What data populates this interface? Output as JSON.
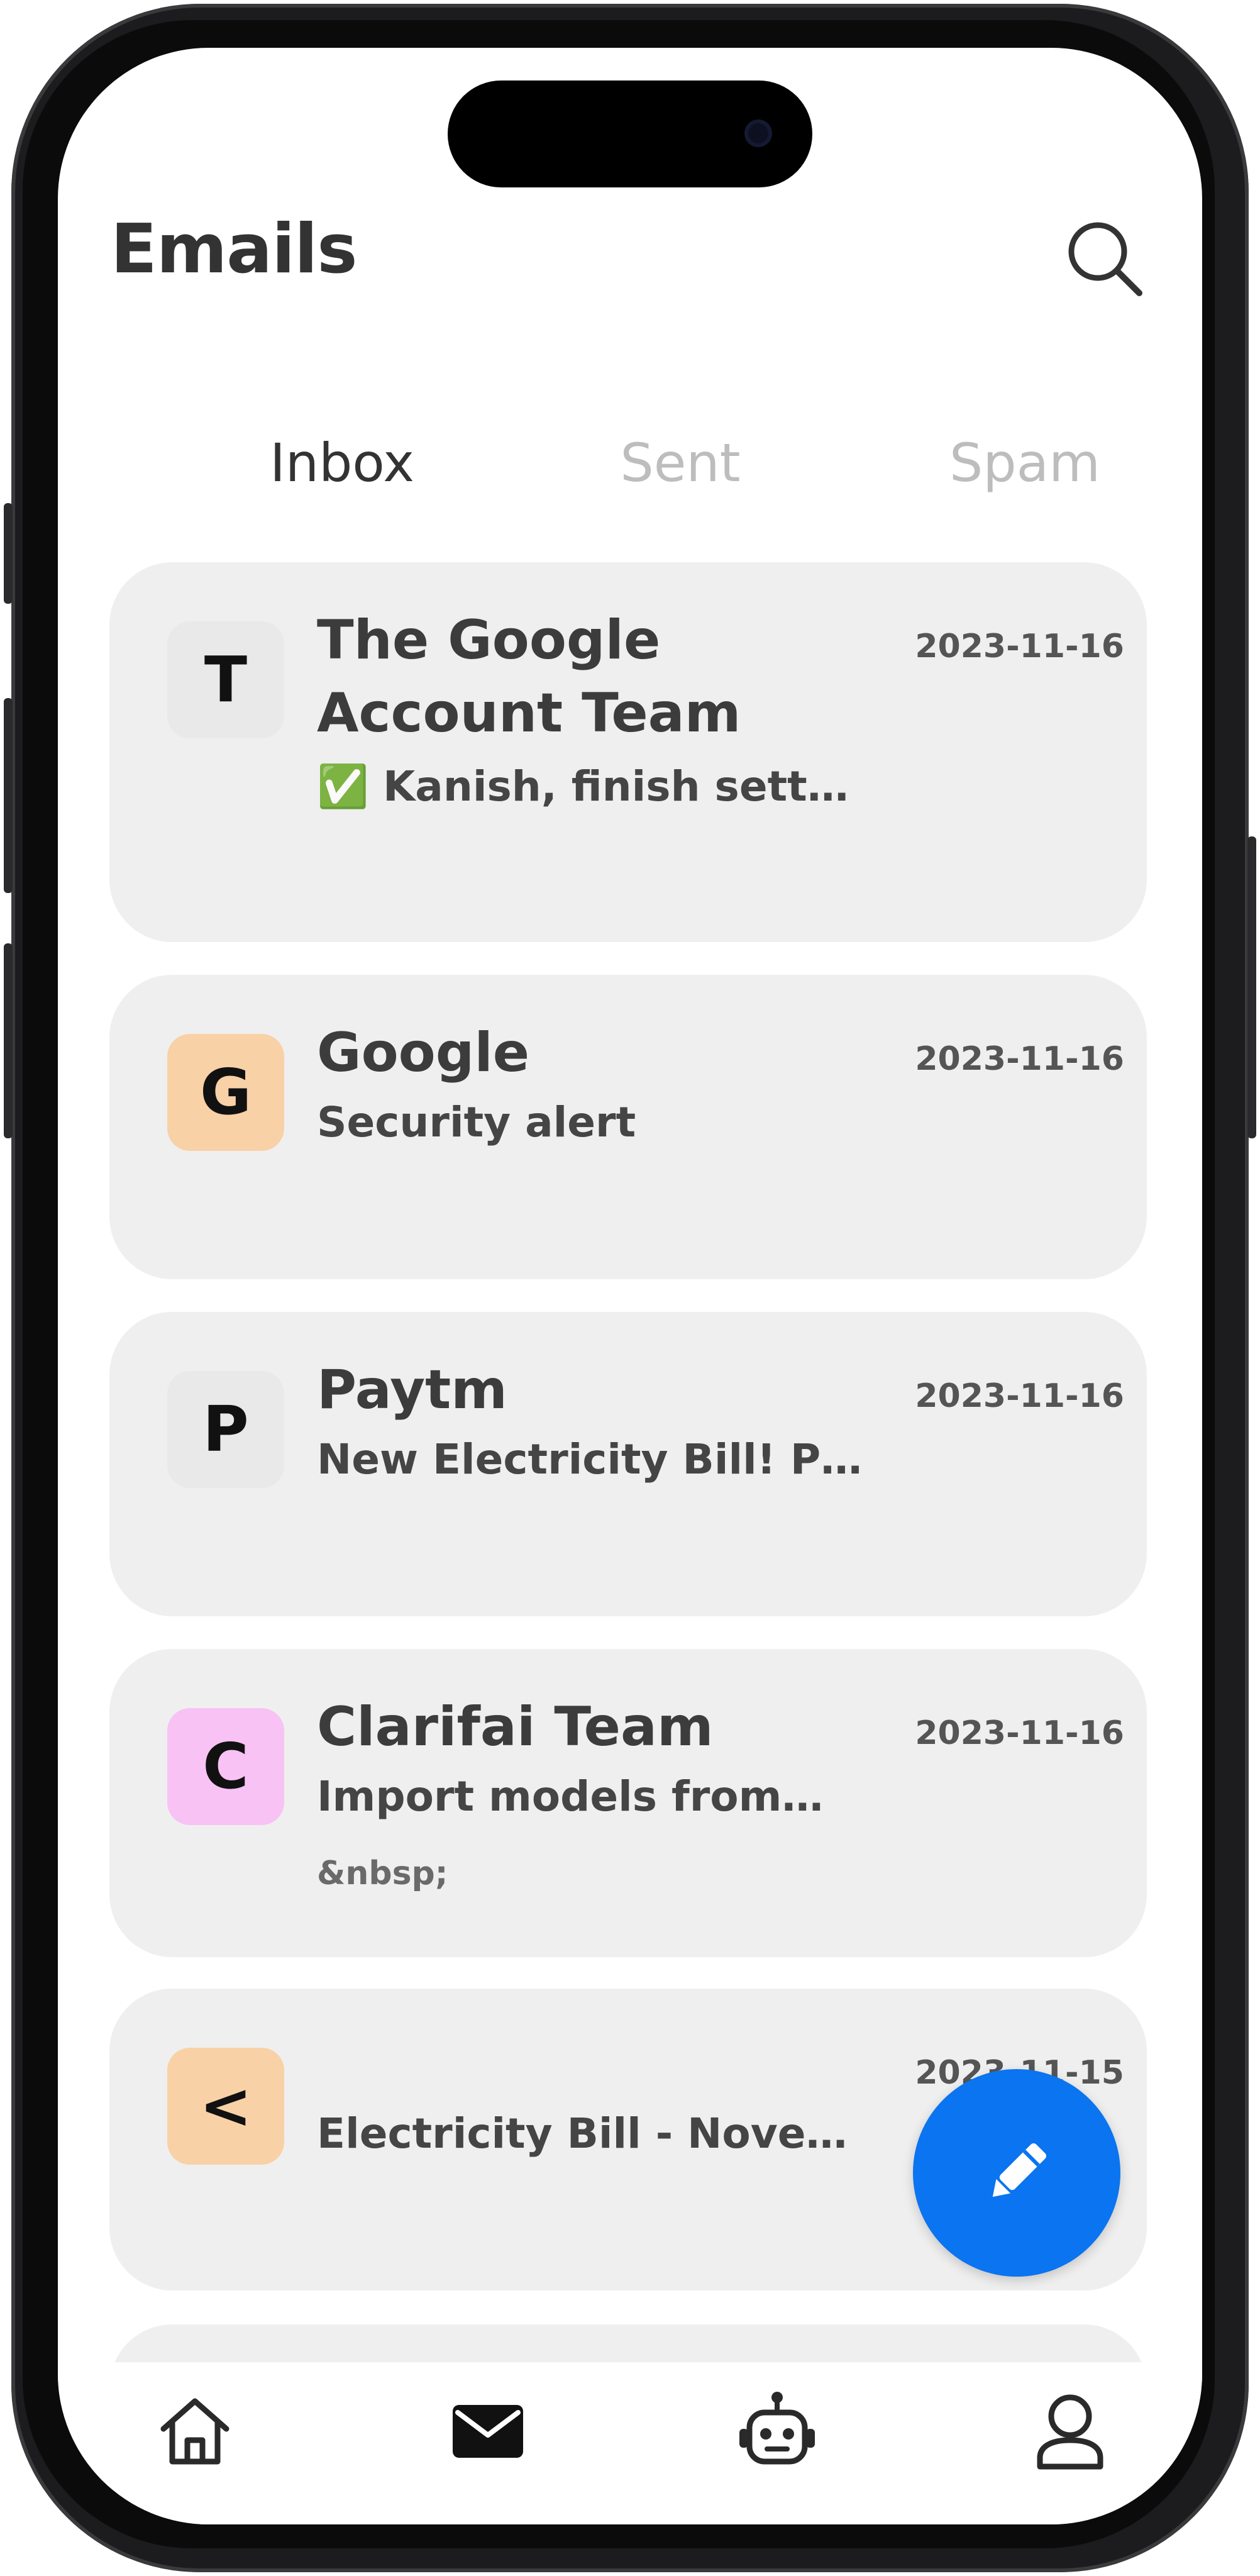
{
  "app": {
    "title": "Emails"
  },
  "header": {
    "search_icon": "search-icon"
  },
  "tabs": [
    {
      "label": "Inbox",
      "active": true
    },
    {
      "label": "Sent",
      "active": false
    },
    {
      "label": "Spam",
      "active": false
    }
  ],
  "emails": [
    {
      "avatar_letter": "T",
      "avatar_color": "#e9e9e9",
      "sender": "The Google Account Team",
      "date": "2023-11-16",
      "subject": "✅ Kanish, finish sett…",
      "snippet": ""
    },
    {
      "avatar_letter": "G",
      "avatar_color": "#f9d1a6",
      "sender": "Google",
      "date": "2023-11-16",
      "subject": "Security alert",
      "snippet": ""
    },
    {
      "avatar_letter": "P",
      "avatar_color": "#e9e9e9",
      "sender": "Paytm",
      "date": "2023-11-16",
      "subject": "New Electricity Bill! P…",
      "snippet": ""
    },
    {
      "avatar_letter": "C",
      "avatar_color": "#f8c2f4",
      "sender": "Clarifai Team",
      "date": "2023-11-16",
      "subject": "Import models from…",
      "snippet": "&nbsp;"
    },
    {
      "avatar_letter": "<",
      "avatar_color": "#f9d1a6",
      "sender": "",
      "date": "2023-11-15",
      "subject": "Electricity Bill - Nove…",
      "snippet": ""
    }
  ],
  "compose": {
    "icon": "pencil-icon",
    "color": "#0b74f0"
  },
  "bottom_nav": [
    {
      "icon": "home-icon",
      "active": false
    },
    {
      "icon": "mail-icon",
      "active": true
    },
    {
      "icon": "robot-icon",
      "active": false
    },
    {
      "icon": "profile-icon",
      "active": false
    }
  ]
}
